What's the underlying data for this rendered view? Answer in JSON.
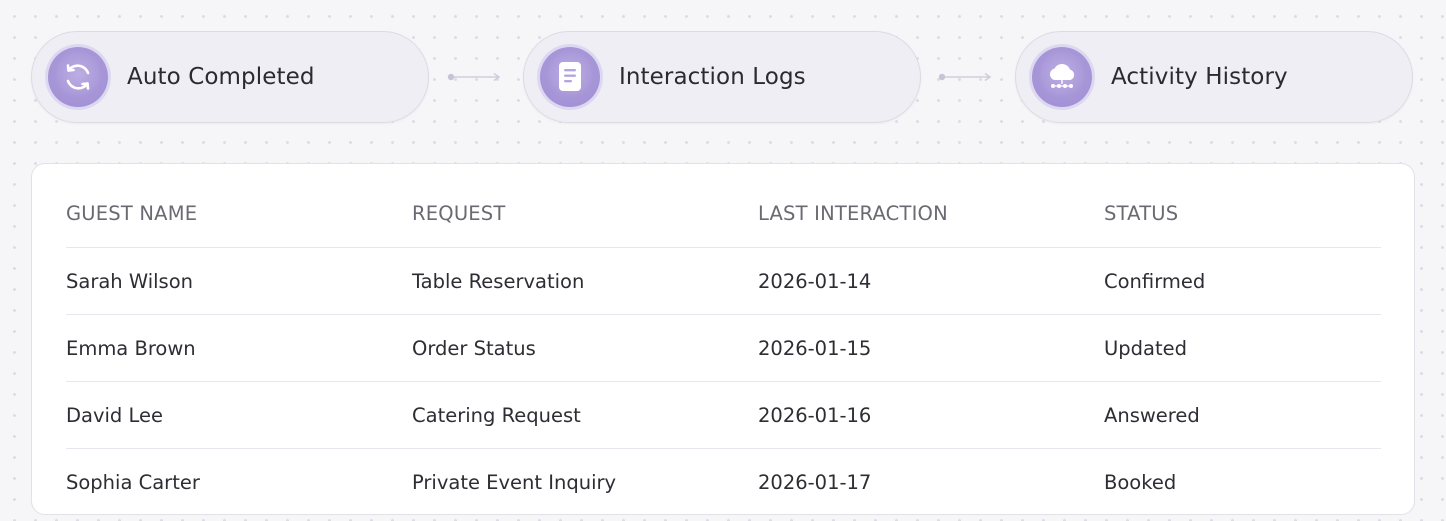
{
  "steps": [
    {
      "label": "Auto Completed",
      "icon": "refresh-icon"
    },
    {
      "label": "Interaction Logs",
      "icon": "document-icon"
    },
    {
      "label": "Activity History",
      "icon": "cloud-icon"
    }
  ],
  "table": {
    "headers": [
      "GUEST NAME",
      "REQUEST",
      "LAST INTERACTION",
      "STATUS"
    ],
    "rows": [
      [
        "Sarah Wilson",
        "Table Reservation",
        "2026-01-14",
        "Confirmed"
      ],
      [
        "Emma Brown",
        "Order Status",
        "2026-01-15",
        "Updated"
      ],
      [
        "David Lee",
        "Catering Request",
        "2026-01-16",
        "Answered"
      ],
      [
        "Sophia Carter",
        "Private Event Inquiry",
        "2026-01-17",
        "Booked"
      ]
    ]
  },
  "colors": {
    "accent": "#a897d8",
    "step_background": "#efeef4",
    "page_background": "#f6f6f8"
  }
}
